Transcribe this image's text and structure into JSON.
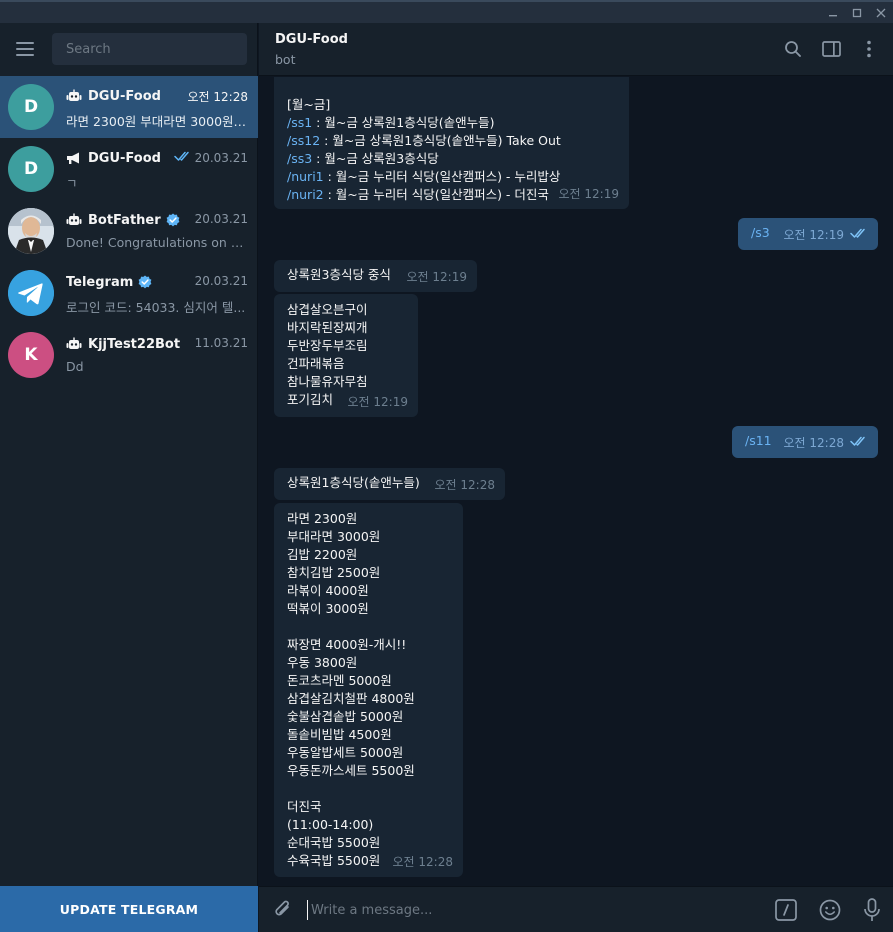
{
  "window": {
    "controls": [
      "minimize",
      "maximize",
      "close"
    ]
  },
  "sidebar": {
    "search_placeholder": "Search",
    "chats": [
      {
        "name": "DGU-Food",
        "avatar_letter": "D",
        "avatar_color": "#3d9e9e",
        "type_icon": "bot-icon",
        "time": "오전 12:28",
        "preview": "라면 2300원 부대라면 3000원 ...",
        "active": true,
        "verified": false,
        "read_check": false
      },
      {
        "name": "DGU-Food",
        "avatar_letter": "D",
        "avatar_color": "#3d9e9e",
        "type_icon": "channel-icon",
        "time": "20.03.21",
        "preview": "ㄱ",
        "active": false,
        "verified": false,
        "read_check": true
      },
      {
        "name": "BotFather",
        "avatar_letter": "",
        "avatar_color": "#c9d6e3",
        "type_icon": "bot-icon",
        "time": "20.03.21",
        "preview": "Done! Congratulations on y...",
        "active": false,
        "verified": true,
        "read_check": false
      },
      {
        "name": "Telegram",
        "avatar_letter": "",
        "avatar_color": "#37a2e0",
        "type_icon": "",
        "time": "20.03.21",
        "preview": "로그인 코드: 54033. 심지어 텔...",
        "active": false,
        "verified": true,
        "read_check": false
      },
      {
        "name": "KjjTest22Bot",
        "avatar_letter": "K",
        "avatar_color": "#cc4f82",
        "type_icon": "bot-icon",
        "time": "11.03.21",
        "preview": "Dd",
        "active": false,
        "verified": false,
        "read_check": false
      }
    ],
    "update_label": "UPDATE TELEGRAM"
  },
  "header": {
    "title": "DGU-Food",
    "subtitle": "bot"
  },
  "messages": [
    {
      "direction": "in",
      "lines": [
        [
          {
            "t": ""
          }
        ],
        [
          {
            "t": "[월~금]"
          }
        ],
        [
          {
            "t": "/ss1",
            "cmd": true
          },
          {
            "t": " : 월~금 상록원1층식당(솥앤누들)"
          }
        ],
        [
          {
            "t": "/ss12",
            "cmd": true
          },
          {
            "t": " : 월~금 상록원1층식당(솥앤누들) Take Out"
          }
        ],
        [
          {
            "t": "/ss3",
            "cmd": true
          },
          {
            "t": " : 월~금 상록원3층식당"
          }
        ],
        [
          {
            "t": "/nuri1",
            "cmd": true
          },
          {
            "t": " : 월~금 누리터 식당(일산캠퍼스) - 누리밥상"
          }
        ],
        [
          {
            "t": "/nuri2",
            "cmd": true
          },
          {
            "t": " : 월~금 누리터 식당(일산캠퍼스) - 더진국"
          }
        ]
      ],
      "time": "오전 12:19"
    },
    {
      "direction": "out",
      "lines": [
        [
          {
            "t": "/s3",
            "cmd": true
          }
        ]
      ],
      "time": "오전 12:19"
    },
    {
      "direction": "in",
      "lines": [
        [
          {
            "t": "상록원3층식당 중식"
          }
        ]
      ],
      "time": "오전 12:19"
    },
    {
      "direction": "in",
      "lines": [
        [
          {
            "t": "삼겹살오븐구이"
          }
        ],
        [
          {
            "t": "바지락된장찌개"
          }
        ],
        [
          {
            "t": "두반장두부조림"
          }
        ],
        [
          {
            "t": "건파래볶음"
          }
        ],
        [
          {
            "t": "참나물유자무침"
          }
        ],
        [
          {
            "t": "포기김치"
          }
        ]
      ],
      "time": "오전 12:19"
    },
    {
      "direction": "out",
      "lines": [
        [
          {
            "t": "/s11",
            "cmd": true
          }
        ]
      ],
      "time": "오전 12:28"
    },
    {
      "direction": "in",
      "lines": [
        [
          {
            "t": "상록원1층식당(솥앤누들)"
          }
        ]
      ],
      "time": "오전 12:28"
    },
    {
      "direction": "in",
      "lines": [
        [
          {
            "t": "라면 2300원"
          }
        ],
        [
          {
            "t": "부대라면 3000원"
          }
        ],
        [
          {
            "t": "김밥 2200원"
          }
        ],
        [
          {
            "t": "참치김밥 2500원"
          }
        ],
        [
          {
            "t": "라볶이 4000원"
          }
        ],
        [
          {
            "t": "떡볶이 3000원"
          }
        ],
        [
          {
            "t": ""
          }
        ],
        [
          {
            "t": "짜장면 4000원-개시!!"
          }
        ],
        [
          {
            "t": "우동 3800원"
          }
        ],
        [
          {
            "t": "돈코츠라멘 5000원"
          }
        ],
        [
          {
            "t": "삼겹살김치철판 4800원"
          }
        ],
        [
          {
            "t": "숯불삼겹솥밥 5000원"
          }
        ],
        [
          {
            "t": "돌솥비빔밥 4500원"
          }
        ],
        [
          {
            "t": "우동알밥세트 5000원"
          }
        ],
        [
          {
            "t": "우동돈까스세트 5500원"
          }
        ],
        [
          {
            "t": ""
          }
        ],
        [
          {
            "t": "더진국"
          }
        ],
        [
          {
            "t": "(11:00-14:00)"
          }
        ],
        [
          {
            "t": "순대국밥 5500원"
          }
        ],
        [
          {
            "t": "수육국밥 5500원"
          }
        ]
      ],
      "time": "오전 12:28"
    }
  ],
  "composer": {
    "placeholder": "Write a message..."
  },
  "colors": {
    "sidebar_bg": "#17212b",
    "chat_bg": "#0e1621",
    "accent": "#2b5278",
    "link": "#6ab3f3",
    "update_button": "#2b6aa8"
  }
}
